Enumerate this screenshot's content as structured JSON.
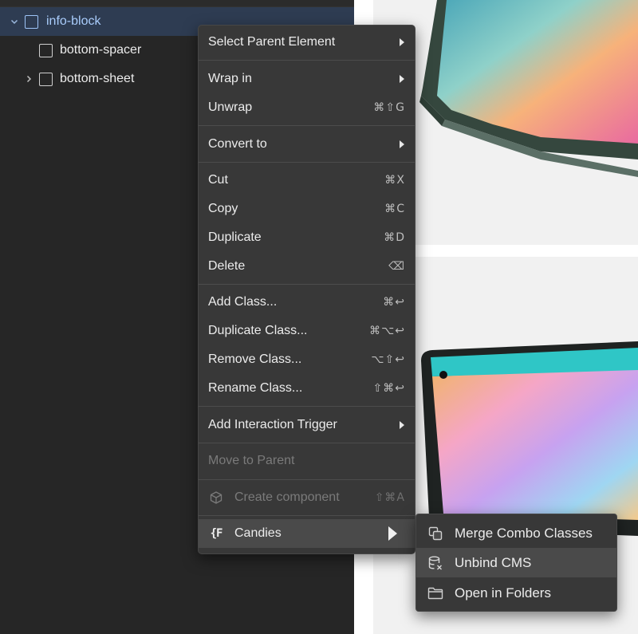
{
  "navigator": {
    "items": [
      {
        "label": "info-block",
        "expanded": true,
        "selected": true
      },
      {
        "label": "bottom-spacer",
        "expanded": null,
        "selected": false
      },
      {
        "label": "bottom-sheet",
        "expanded": false,
        "selected": false
      }
    ]
  },
  "context_menu": {
    "items": [
      {
        "label": "Select Parent Element",
        "submenu": true
      },
      {
        "label": "Wrap in",
        "submenu": true
      },
      {
        "label": "Unwrap",
        "shortcut": "⌘⇧G"
      },
      {
        "label": "Convert to",
        "submenu": true
      },
      {
        "label": "Cut",
        "shortcut": "⌘X"
      },
      {
        "label": "Copy",
        "shortcut": "⌘C"
      },
      {
        "label": "Duplicate",
        "shortcut": "⌘D"
      },
      {
        "label": "Delete",
        "shortcut": "⌫"
      },
      {
        "label": "Add Class...",
        "shortcut": "⌘↩"
      },
      {
        "label": "Duplicate Class...",
        "shortcut": "⌘⌥↩"
      },
      {
        "label": "Remove Class...",
        "shortcut": "⌥⇧↩"
      },
      {
        "label": "Rename Class...",
        "shortcut": "⇧⌘↩"
      },
      {
        "label": "Add Interaction Trigger",
        "submenu": true
      },
      {
        "label": "Move to Parent",
        "disabled": true
      },
      {
        "label": "Create component",
        "shortcut": "⇧⌘A",
        "disabled": true,
        "icon": "cube-icon"
      },
      {
        "label": "Candies",
        "submenu": true,
        "highlighted": true,
        "icon": "candies-logo-icon",
        "icon_text": "{F"
      }
    ]
  },
  "submenu": {
    "items": [
      {
        "label": "Merge Combo Classes",
        "icon": "merge-squares-icon"
      },
      {
        "label": "Unbind CMS",
        "icon": "database-unbind-icon",
        "highlighted": true
      },
      {
        "label": "Open in Folders",
        "icon": "folder-icon"
      }
    ]
  },
  "colors": {
    "panel_bg": "#262626",
    "menu_bg": "#383838",
    "menu_highlight": "#4a4a4a",
    "selection_bg": "#2e3c52",
    "selection_text": "#a9ccfb",
    "canvas_card": "#f1f1f1"
  }
}
